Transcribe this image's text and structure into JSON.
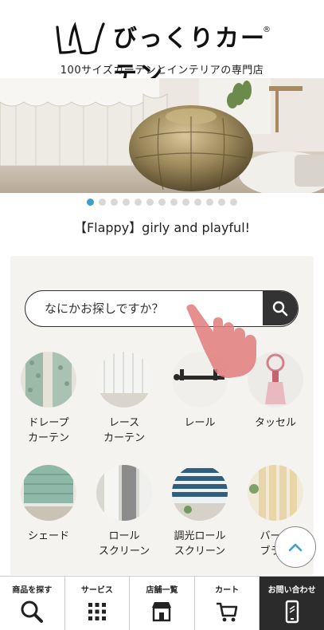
{
  "header": {
    "logo_text": "びっくりカーテン",
    "logo_mark": "®",
    "tagline": "100サイズカーテンとインテリアの専門店"
  },
  "carousel": {
    "dot_count": 13,
    "active_index": 0,
    "caption": "【Flappy】girly and playful!"
  },
  "search": {
    "placeholder": "なにかお探しですか？",
    "button_icon": "search-icon"
  },
  "categories": [
    {
      "label": "ドレープ\nカーテン",
      "icon": "drape-curtain-photo"
    },
    {
      "label": "レース\nカーテン",
      "icon": "lace-curtain-photo"
    },
    {
      "label": "レール",
      "icon": "curtain-rail-photo"
    },
    {
      "label": "タッセル",
      "icon": "tassel-photo"
    },
    {
      "label": "シェード",
      "icon": "shade-photo"
    },
    {
      "label": "ロール\nスクリーン",
      "icon": "roll-screen-photo"
    },
    {
      "label": "調光ロール\nスクリーン",
      "icon": "dimming-roll-screen-photo"
    },
    {
      "label": "バーチ\nブライ",
      "icon": "vertical-blind-photo"
    }
  ],
  "bottom_nav": [
    {
      "label": "商品を探す",
      "icon": "search-icon"
    },
    {
      "label": "サービス",
      "icon": "grid-icon"
    },
    {
      "label": "店舗一覧",
      "icon": "store-icon"
    },
    {
      "label": "カート",
      "icon": "cart-icon"
    },
    {
      "label": "お問い合わせ",
      "icon": "phone-icon"
    }
  ],
  "colors": {
    "accent": "#3aa2c8",
    "panel_bg": "#f4f3f0",
    "dark": "#2b2b2b",
    "hand": "#e07b7b"
  }
}
